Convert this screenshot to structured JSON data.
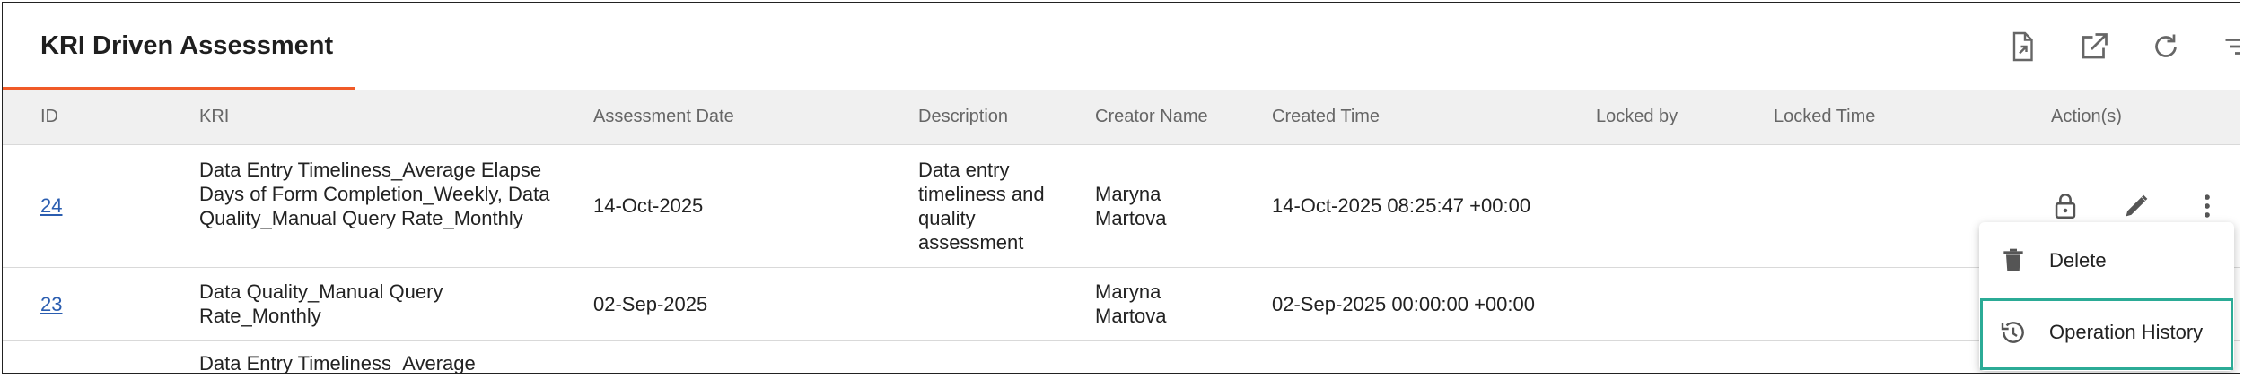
{
  "header": {
    "title": "KRI Driven Assessment"
  },
  "toolbar": {
    "icons": [
      "export-file-icon",
      "open-external-icon",
      "refresh-icon",
      "filter-icon",
      "add-icon"
    ],
    "accent_color": "#f05a28"
  },
  "table": {
    "columns": [
      "ID",
      "KRI",
      "Assessment Date",
      "Description",
      "Creator Name",
      "Created Time",
      "Locked by",
      "Locked Time",
      "Action(s)"
    ],
    "rows": [
      {
        "id": "24",
        "kri": "Data Entry Timeliness_Average Elapse Days of Form Completion_Weekly, Data Quality_Manual Query Rate_Monthly",
        "assessment_date": "14-Oct-2025",
        "description": "Data entry timeliness and quality assessment",
        "creator_name": "Maryna Martova",
        "created_time": "14-Oct-2025 08:25:47 +00:00",
        "locked_by": "",
        "locked_time": ""
      },
      {
        "id": "23",
        "kri": "Data Quality_Manual Query Rate_Monthly",
        "assessment_date": "02-Sep-2025",
        "description": "",
        "creator_name": "Maryna Martova",
        "created_time": "02-Sep-2025 00:00:00 +00:00",
        "locked_by": "",
        "locked_time": ""
      },
      {
        "id": "",
        "kri": "Data Entry Timeliness_Average",
        "assessment_date": "",
        "description": "",
        "creator_name": "",
        "created_time": "",
        "locked_by": "",
        "locked_time": ""
      }
    ]
  },
  "row_actions": {
    "icons": [
      "lock-icon",
      "edit-icon",
      "more-vert-icon"
    ]
  },
  "context_menu": {
    "items": [
      {
        "label": "Delete",
        "icon": "delete-icon"
      },
      {
        "label": "Operation History",
        "icon": "history-icon"
      }
    ],
    "highlight_color": "#2bab96"
  }
}
